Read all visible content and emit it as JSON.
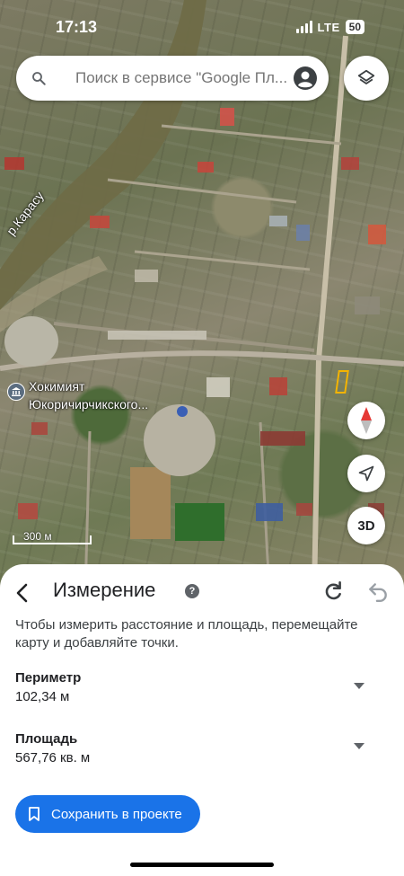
{
  "status_bar": {
    "time": "17:13",
    "network": "LTE",
    "battery": "50"
  },
  "search": {
    "placeholder": "Поиск в сервисе \"Google Пл..."
  },
  "map": {
    "river_label": "р.Карасу",
    "poi_label": "Хокимият Юкоричирчикского...",
    "scale_label": "300 м",
    "button_3d": "3D"
  },
  "measure": {
    "title": "Измерение",
    "help": "?",
    "instructions": "Чтобы измерить расстояние и площадь, перемещайте карту и добавляйте точки.",
    "perimeter_label": "Периметр",
    "perimeter_value": "102,34 м",
    "area_label": "Площадь",
    "area_value": "567,76 кв. м",
    "save_label": "Сохранить в проекте"
  },
  "colors": {
    "accent": "#1a73e8",
    "measure_outline": "#f5b400",
    "compass_red": "#e53935"
  }
}
